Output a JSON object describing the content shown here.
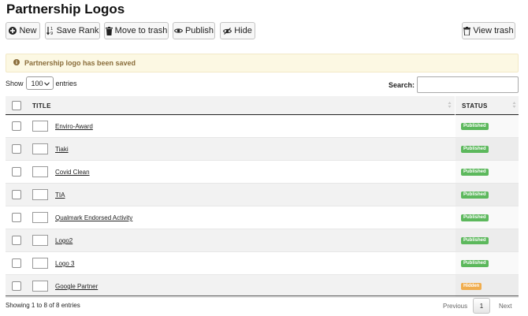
{
  "page": {
    "title": "Partnership Logos"
  },
  "toolbar": {
    "new_label": "New",
    "save_rank_label": "Save Rank",
    "move_to_trash_label": "Move to trash",
    "publish_label": "Publish",
    "hide_label": "Hide",
    "view_trash_label": "View trash"
  },
  "alert": {
    "message": "Partnership logo has been saved",
    "color": "#fcf8e3"
  },
  "length_menu": {
    "show_label": "Show",
    "value": "100",
    "entries_label": "entries"
  },
  "search": {
    "label": "Search:",
    "value": ""
  },
  "table": {
    "columns": {
      "title": "TITLE",
      "status": "STATUS"
    },
    "rows": [
      {
        "title": "Enviro-Award",
        "status": "Published"
      },
      {
        "title": "Tiaki",
        "status": "Published"
      },
      {
        "title": "Covid Clean",
        "status": "Published"
      },
      {
        "title": "TIA",
        "status": "Published"
      },
      {
        "title": "Qualmark Endorsed Activity",
        "status": "Published"
      },
      {
        "title": "Logo2",
        "status": "Published"
      },
      {
        "title": "Logo 3",
        "status": "Published"
      },
      {
        "title": "Google Partner",
        "status": "Hidden"
      }
    ]
  },
  "footer": {
    "info": "Showing 1 to 8 of 8 entries",
    "previous_label": "Previous",
    "current_page": "1",
    "next_label": "Next"
  },
  "colors": {
    "published": "#5cb85c",
    "hidden": "#f0ad4e"
  }
}
